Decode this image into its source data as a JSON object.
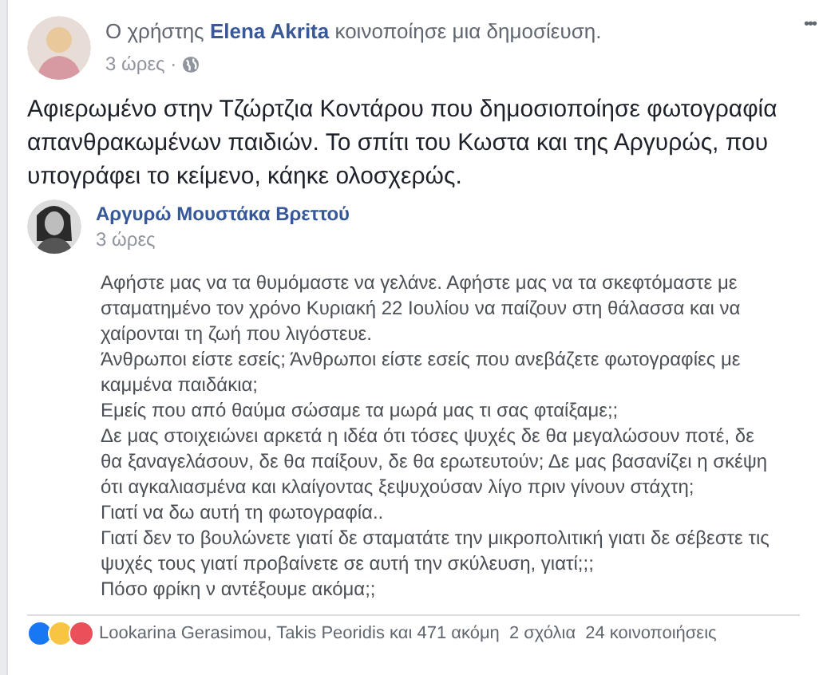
{
  "post": {
    "author_prefix": "Ο χρήστης",
    "author": "Elena Akrita",
    "action": "κοινοποίησε μια δημοσίευση.",
    "time": "3 ώρες ·",
    "menu": "•••",
    "text": "Αφιερωμένο στην Τζώρτζια Κοντάρου που δημοσιοποίησε φωτογραφία απανθρακωμένων παιδιών. Το σπίτι του Κωστα και της Αργυρώς, που υπογράφει το κείμενο, κάηκε ολοσχερώς."
  },
  "shared": {
    "author": "Αργυρώ Μουστάκα Βρεττού",
    "time": "3 ώρες",
    "paragraphs": [
      "Αφήστε μας να τα θυμόμαστε να γελάνε. Αφήστε μας να τα σκεφτόμαστε με σταματημένο τον χρόνο Κυριακή 22 Ιουλίου να παίζουν στη θάλασσα και να χαίρονται τη ζωή που λιγόστευε.",
      "Άνθρωποι είστε εσείς; Άνθρωποι είστε εσείς που ανεβάζετε φωτογραφίες με καμμένα παιδάκια;",
      "Εμείς που από θαύμα σώσαμε τα μωρά μας τι σας φταίξαμε;;",
      "Δε μας στοιχειώνει αρκετά η ιδέα ότι τόσες ψυχές δε θα μεγαλώσουν ποτέ, δε θα ξαναγελάσουν, δε θα παίξουν, δε θα ερωτευτούν; Δε μας βασανίζει η σκέψη ότι αγκαλιασμένα και κλαίγοντας ξεψυχούσαν λίγο πριν γίνουν στάχτη;",
      "Γιατί να δω αυτή τη φωτογραφία..",
      "Γιατί δεν το βουλώνετε γιατί δε σταματάτε την μικροπολιτική γιατι δε σέβεστε τις ψυχές τους γιατί προβαίνετε σε αυτή την σκύλευση, γιατί;;;",
      "Πόσο φρίκη ν αντέξουμε ακόμα;;"
    ]
  },
  "reactions": {
    "icons": [
      {
        "kind": "like"
      },
      {
        "kind": "haha"
      },
      {
        "kind": "love"
      }
    ],
    "people": "Lookarina Gerasimou, Takis Peoridis και 471 ακόμη",
    "comments": "2 σχόλια",
    "shares": "24 κοινοποιήσεις"
  }
}
